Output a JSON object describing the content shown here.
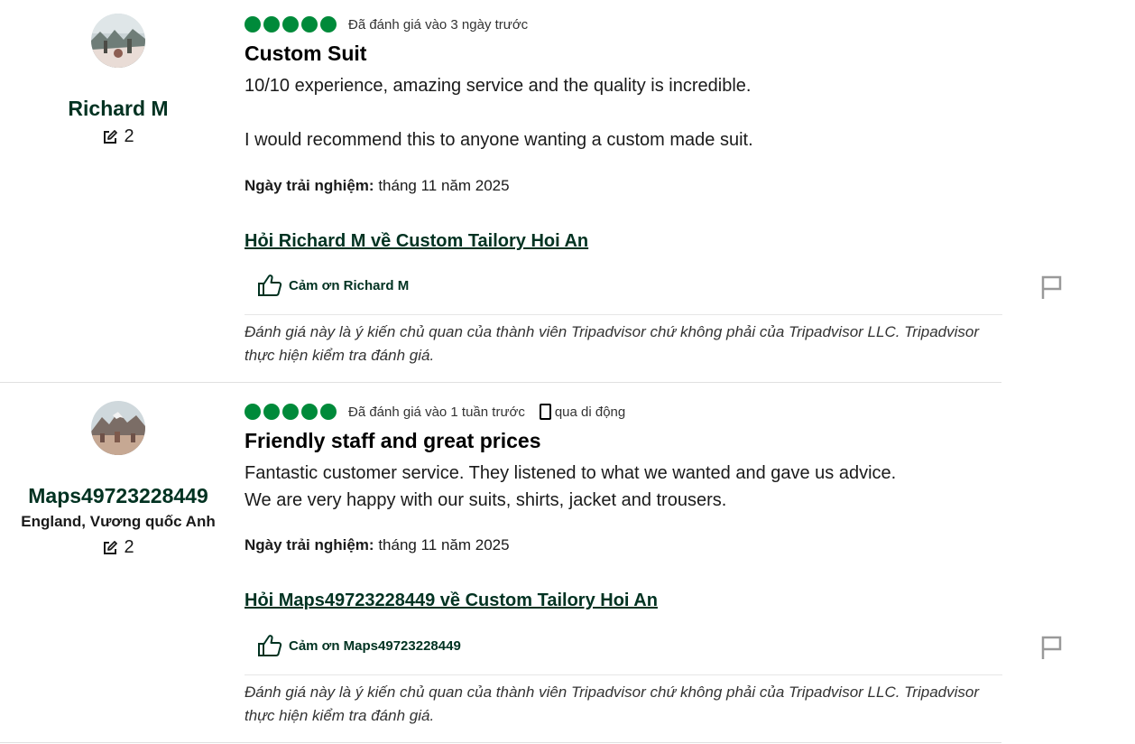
{
  "reviews": [
    {
      "username": "Richard M",
      "location": "",
      "contributions": "2",
      "rating": 5,
      "date_text": "Đã đánh giá vào 3 ngày trước",
      "device_text": "",
      "title": "Custom Suit",
      "body": [
        "10/10 experience, amazing service and the quality is incredible.",
        "I would recommend this to anyone wanting a custom made suit."
      ],
      "experience_label": "Ngày trải nghiệm:",
      "experience_date": "tháng 11 năm 2025",
      "ask_link": "Hỏi Richard M về Custom Tailory Hoi An",
      "thanks_label": "Cảm ơn Richard M",
      "disclaimer": "Đánh giá này là ý kiến chủ quan của thành viên Tripadvisor chứ không phải của Tripadvisor LLC. Tripadvisor thực hiện kiểm tra đánh giá.",
      "avatar_icon": "winter-landscape-photo"
    },
    {
      "username": "Maps49723228449",
      "location": "England, Vương quốc Anh",
      "contributions": "2",
      "rating": 5,
      "date_text": "Đã đánh giá vào 1 tuần trước",
      "device_text": "qua di động",
      "title": "Friendly staff and great prices",
      "body": [
        "Fantastic customer service. They listened to what we wanted and gave us advice.",
        "We are very happy with our suits, shirts, jacket and trousers."
      ],
      "experience_label": "Ngày trải nghiệm:",
      "experience_date": "tháng 11 năm 2025",
      "ask_link": "Hỏi Maps49723228449 về Custom Tailory Hoi An",
      "thanks_label": "Cảm ơn Maps49723228449",
      "disclaimer": "Đánh giá này là ý kiến chủ quan của thành viên Tripadvisor chứ không phải của Tripadvisor LLC. Tripadvisor thực hiện kiểm tra đánh giá.",
      "avatar_icon": "mountain-landscape-photo"
    }
  ],
  "colors": {
    "bubble": "#008a3a",
    "link": "#003221",
    "divider": "#e6e6e6"
  },
  "icons": {
    "contribution": "pencil-square-icon",
    "thanks": "thumbs-up-icon",
    "flag": "flag-icon",
    "mobile": "mobile-phone-icon"
  }
}
